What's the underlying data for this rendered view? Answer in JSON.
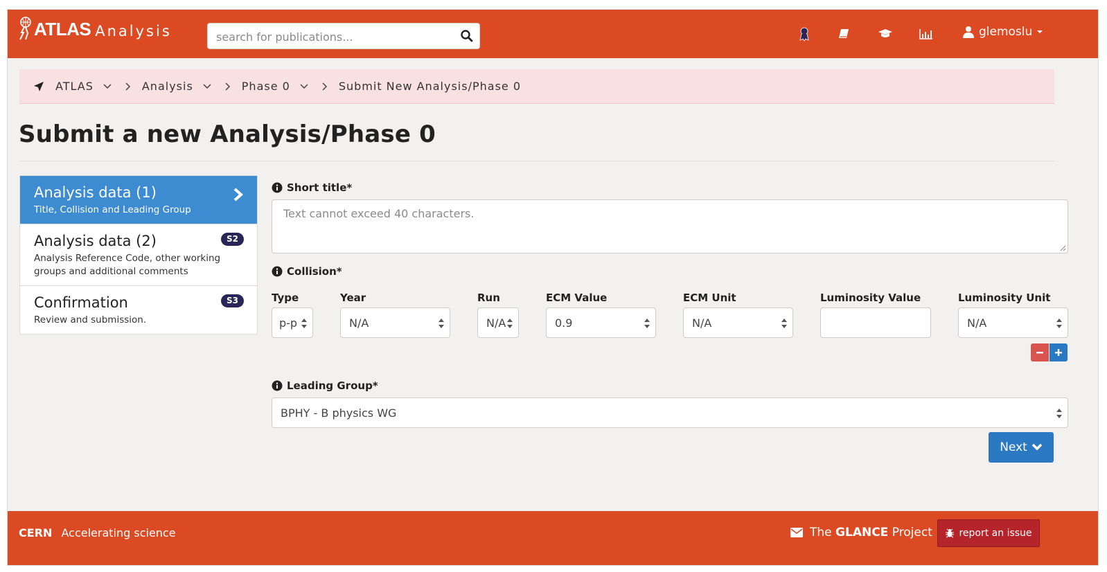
{
  "header": {
    "logo_atlas": "ATLAS",
    "logo_analysis": "Analysis",
    "search_placeholder": "search for publications...",
    "user_name": "glemoslu"
  },
  "breadcrumb": {
    "items": [
      "ATLAS",
      "Analysis",
      "Phase 0",
      "Submit New Analysis/Phase 0"
    ]
  },
  "page_title": "Submit a new Analysis/Phase 0",
  "steps": [
    {
      "title": "Analysis data (1)",
      "desc": "Title, Collision and Leading Group",
      "badge": ""
    },
    {
      "title": "Analysis data (2)",
      "desc": "Analysis Reference Code, other working groups and additional comments",
      "badge": "S2"
    },
    {
      "title": "Confirmation",
      "desc": "Review and submission.",
      "badge": "S3"
    }
  ],
  "form": {
    "short_title_label": "Short title*",
    "short_title_placeholder": "Text cannot exceed 40 characters.",
    "collision_label": "Collision*",
    "collision_columns": {
      "type": "Type",
      "year": "Year",
      "run": "Run",
      "ecm_value": "ECM Value",
      "ecm_unit": "ECM Unit",
      "lumi_value": "Luminosity Value",
      "lumi_unit": "Luminosity Unit"
    },
    "collision_values": {
      "type": "p-p",
      "year": "N/A",
      "run": "N/A",
      "ecm_value": "0.9",
      "ecm_unit": "N/A",
      "lumi_value": "",
      "lumi_unit": "N/A"
    },
    "leading_group_label": "Leading Group*",
    "leading_group_value": "BPHY - B physics WG",
    "next_label": "Next"
  },
  "footer": {
    "cern": "CERN",
    "tagline": "Accelerating science",
    "project_prefix": "The",
    "project_name": "GLANCE",
    "project_suffix": "Project",
    "report_label": "report an issue"
  },
  "colors": {
    "header_bg": "#dc4a23",
    "active_step": "#3d8bd0",
    "badge": "#2b2456",
    "primary_button": "#2a79c2",
    "danger": "#d9534f",
    "breadcrumb_bg": "#f9e1e1"
  },
  "icons": {
    "nav": [
      "award-icon",
      "book-icon",
      "graduation-cap-icon",
      "bar-chart-icon"
    ],
    "user": "user-icon"
  }
}
